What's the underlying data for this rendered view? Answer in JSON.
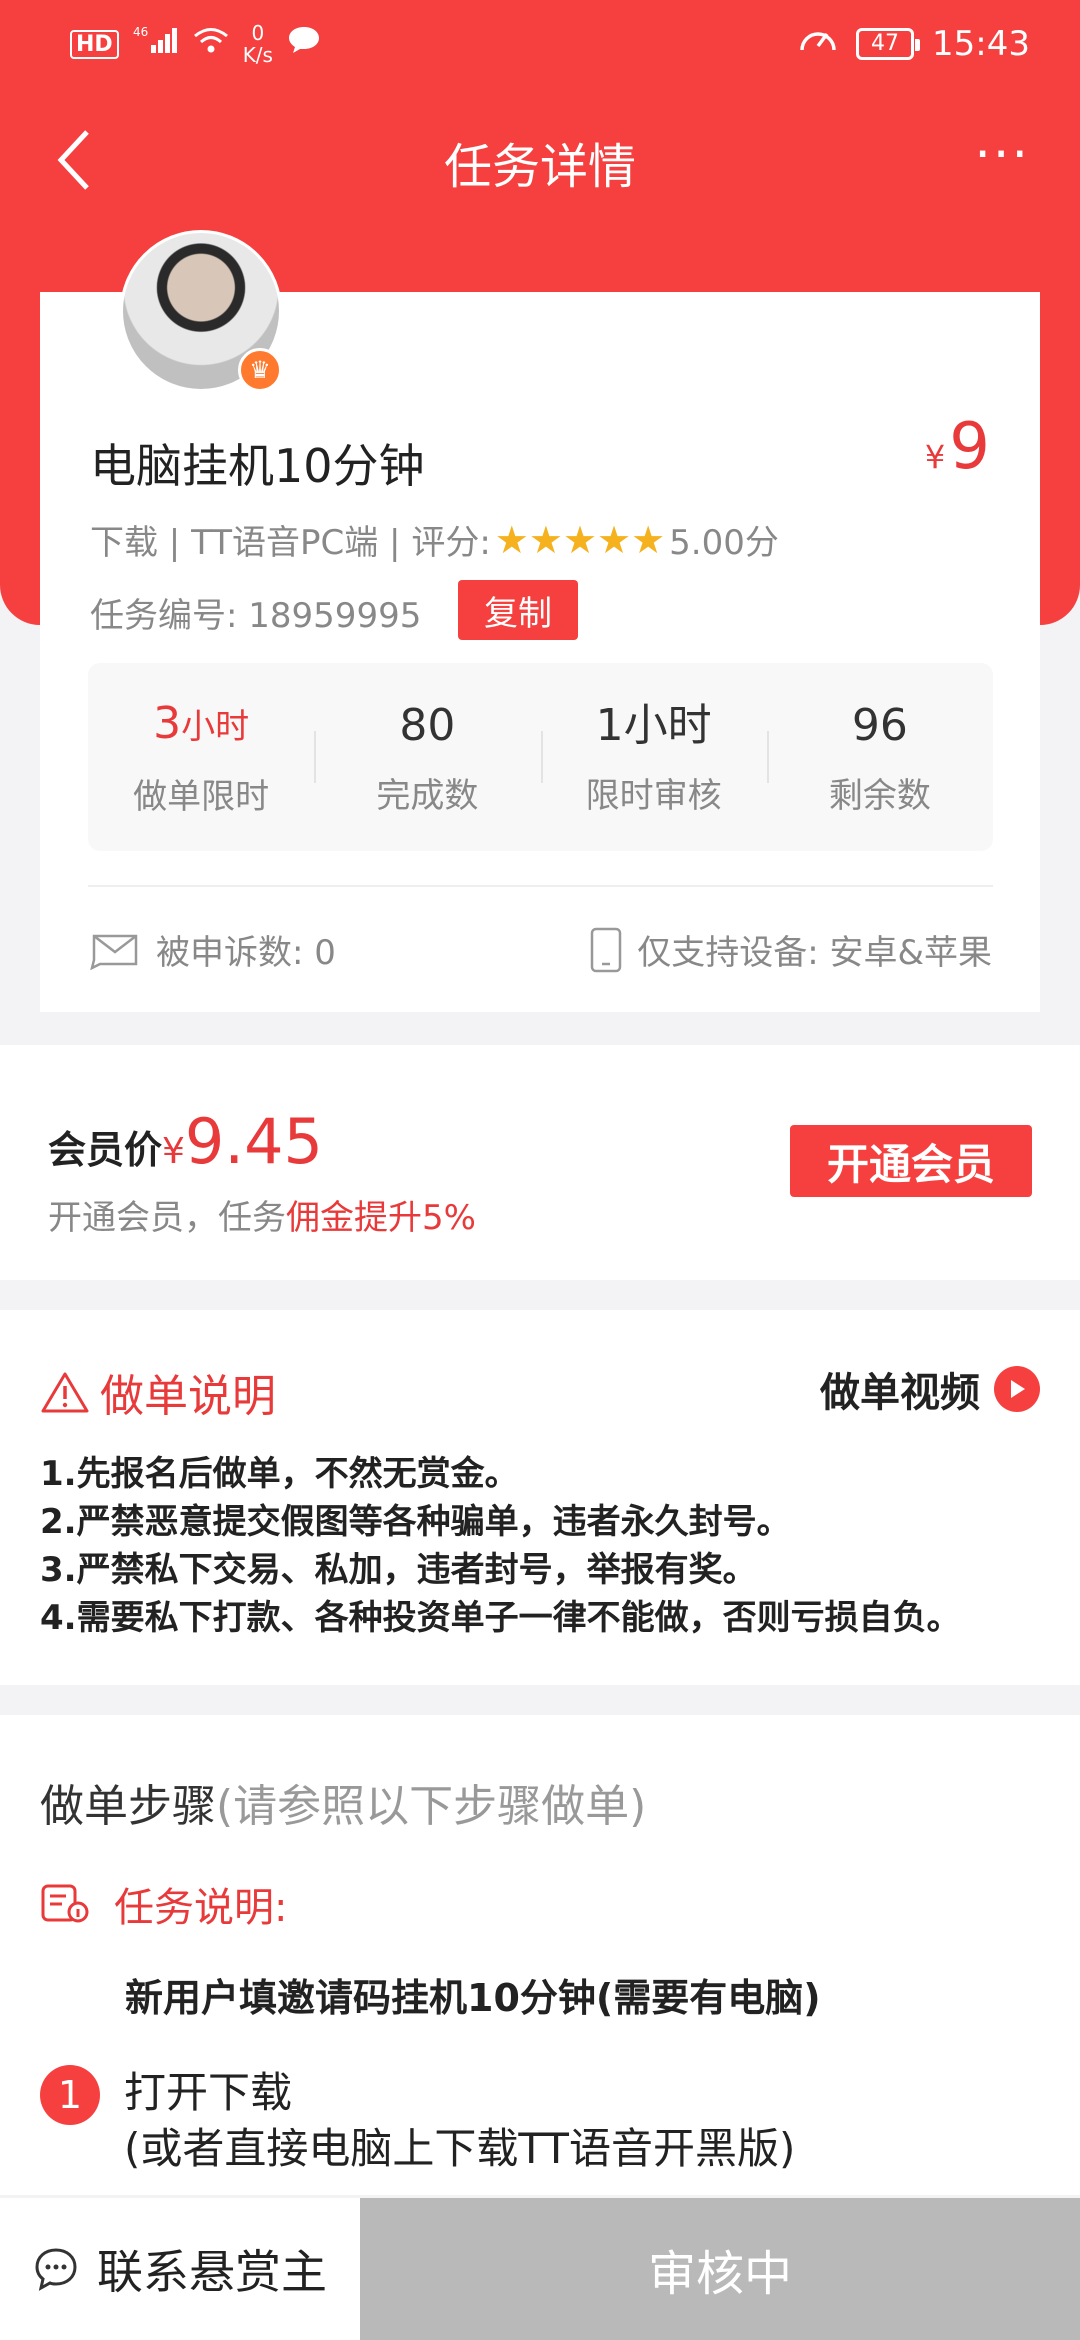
{
  "status_bar": {
    "hd": "HD",
    "network": "46",
    "speed_value": "0",
    "speed_unit": "K/s",
    "battery": "47",
    "time": "15:43"
  },
  "nav": {
    "title": "任务详情",
    "more": "···"
  },
  "task": {
    "title": "电脑挂机10分钟",
    "price_symbol": "¥",
    "price": "9",
    "meta_text": "下载 | TT语音PC端 | 评分:",
    "rating_stars": 5,
    "rating": "5.00分",
    "task_no_label": "任务编号:",
    "task_no": "18959995",
    "copy_label": "复制"
  },
  "stats": [
    {
      "value": "3",
      "unit": "小时",
      "label": "做单限时"
    },
    {
      "value": "80",
      "unit": "",
      "label": "完成数"
    },
    {
      "value": "1小时",
      "unit": "",
      "label": "限时审核"
    },
    {
      "value": "96",
      "unit": "",
      "label": "剩余数"
    }
  ],
  "complaints": "被申诉数: 0",
  "devices": "仅支持设备: 安卓&苹果",
  "member": {
    "label": "会员价",
    "price_symbol": "¥",
    "price": "9.45",
    "desc_prefix": "开通会员，任务",
    "desc_highlight": "佣金提升5%",
    "button": "开通会员"
  },
  "notes": {
    "title": "做单说明",
    "video_label": "做单视频",
    "rules": [
      "1.先报名后做单，不然无赏金。",
      "2.严禁恶意提交假图等各种骗单，违者永久封号。",
      "3.严禁私下交易、私加，违者封号，举报有奖。",
      "4.需要私下打款、各种投资单子一律不能做，否则亏损自负。"
    ]
  },
  "steps": {
    "title": "做单步骤",
    "subtitle": "(请参照以下步骤做单)",
    "task_desc_label": "任务说明:",
    "task_desc": "新用户填邀请码挂机10分钟(需要有电脑)",
    "step1_num": "1",
    "step1_line1": "打开下载",
    "step1_line2": "(或者直接电脑上下载TT语音开黑版)"
  },
  "bottom": {
    "contact": "联系悬赏主",
    "status": "审核中"
  },
  "colors": {
    "brand_red": "#f5403f",
    "price_red": "#e83a3a",
    "star": "#f5b11e",
    "disabled": "#b9b9b9"
  }
}
